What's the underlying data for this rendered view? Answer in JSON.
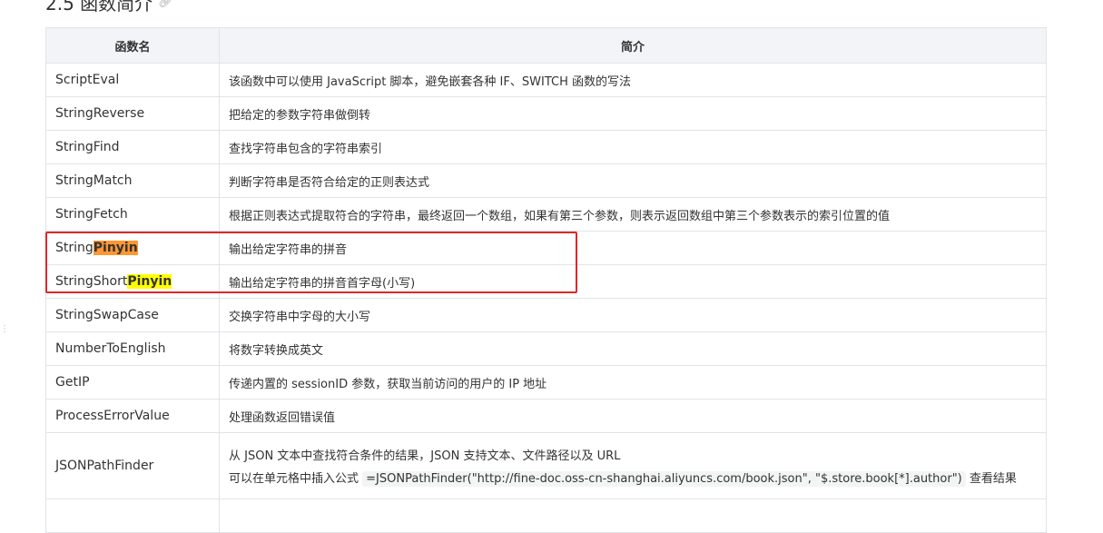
{
  "heading": {
    "text": "2.5 函数简介"
  },
  "table": {
    "headers": {
      "name": "函数名",
      "desc": "简介"
    },
    "rows": [
      {
        "name": "ScriptEval",
        "desc": "该函数中可以使用 JavaScript 脚本，避免嵌套各种 IF、SWITCH 函数的写法"
      },
      {
        "name": "StringReverse",
        "desc": "把给定的参数字符串做倒转"
      },
      {
        "name": "StringFind",
        "desc": "查找字符串包含的字符串索引"
      },
      {
        "name": "StringMatch",
        "desc": "判断字符串是否符合给定的正则表达式"
      },
      {
        "name": "StringFetch",
        "desc": "根据正则表达式提取符合的字符串，最终返回一个数组，如果有第三个参数，则表示返回数组中第三个参数表示的索引位置的值"
      },
      {
        "name_prefix": "String",
        "name_highlight": "Pinyin",
        "desc": "输出给定字符串的拼音"
      },
      {
        "name_prefix": "StringShort",
        "name_highlight": "Pinyin",
        "desc": "输出给定字符串的拼音首字母(小写)"
      },
      {
        "name": "StringSwapCase",
        "desc": "交换字符串中字母的大小写"
      },
      {
        "name": "NumberToEnglish",
        "desc": "将数字转换成英文"
      },
      {
        "name": "GetIP",
        "desc": "传递内置的 sessionID 参数，获取当前访问的用户的 IP 地址"
      },
      {
        "name": "ProcessErrorValue",
        "desc": "处理函数返回错误值"
      },
      {
        "name": "JSONPathFinder",
        "desc_line1": "从 JSON 文本中查找符合条件的结果，JSON 支持文本、文件路径以及 URL",
        "desc_line2_prefix": "可以在单元格中插入公式",
        "desc_line2_code": "=JSONPathFinder(\"http://fine-doc.oss-cn-shanghai.aliyuncs.com/book.json\", \"$.store.book[*].author\")",
        "desc_line2_suffix": "查看结果"
      }
    ]
  },
  "colors": {
    "highlight_orange": "#ff9632",
    "highlight_yellow": "#ffff00",
    "box_red": "#e0262b",
    "header_bg": "#f3f4f7"
  }
}
